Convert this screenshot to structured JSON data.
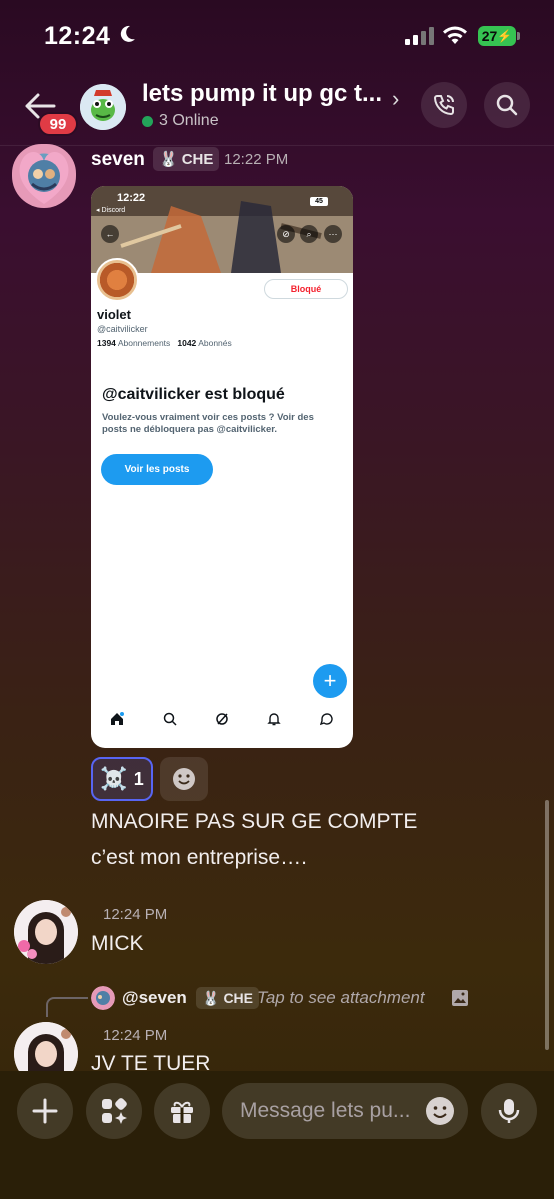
{
  "status_bar": {
    "time": "12:24",
    "battery": "27"
  },
  "header": {
    "unread_badge": "99",
    "title": "lets pump it up gc t...",
    "online": "3 Online"
  },
  "messages": [
    {
      "author": "seven",
      "tag": "CHE",
      "time": "12:22 PM",
      "attachment": {
        "status_time": "12:22",
        "app_back_label": "◂ Discord",
        "battery": "45",
        "blocked_button": "Bloqué",
        "name": "violet",
        "handle": "@caitvilicker",
        "following_count": "1394",
        "following_label": "Abonnements",
        "followers_count": "1042",
        "followers_label": "Abonnés",
        "blocked_heading": "@caitvilicker est bloqué",
        "blocked_text": "Voulez-vous vraiment voir ces posts ? Voir des posts ne débloquera pas @caitvilicker.",
        "cta": "Voir les posts"
      },
      "reaction_count": "1",
      "lines": [
        "MNAOIRE PAS SUR GE COMPTE",
        "c’est mon entreprise…."
      ]
    },
    {
      "time": "12:24 PM",
      "text": "MICK"
    },
    {
      "reply": {
        "author": "@seven",
        "tag": "CHE",
        "text": "Tap to see attachment"
      },
      "time": "12:24 PM",
      "text": "JV TE TUER"
    }
  ],
  "composer": {
    "placeholder": "Message lets pu..."
  },
  "colors": {
    "online": "#23a55a",
    "badge": "#e03b45",
    "twitter_blue": "#1d9bf0",
    "blocked_red": "#f4212e"
  }
}
